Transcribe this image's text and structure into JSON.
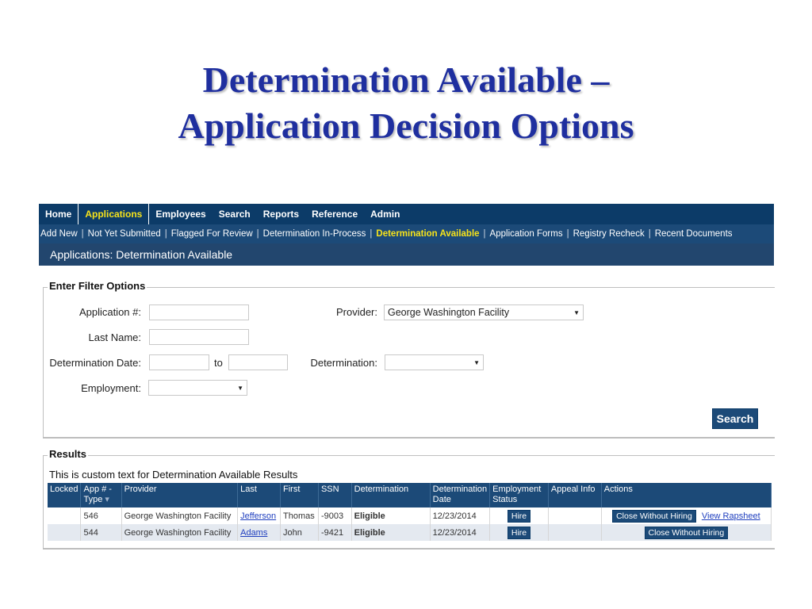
{
  "slide": {
    "title_line1": "Determination Available –",
    "title_line2": "Application Decision Options"
  },
  "topnav": {
    "items": [
      "Home",
      "Applications",
      "Employees",
      "Search",
      "Reports",
      "Reference",
      "Admin"
    ],
    "active": "Applications"
  },
  "subnav": {
    "items": [
      "Add New",
      "Not Yet Submitted",
      "Flagged For Review",
      "Determination In-Process",
      "Determination Available",
      "Application Forms",
      "Registry Recheck",
      "Recent Documents"
    ],
    "active": "Determination Available"
  },
  "page_header": "Applications: Determination Available",
  "filter": {
    "legend": "Enter Filter Options",
    "application_label": "Application #:",
    "application_value": "",
    "last_name_label": "Last Name:",
    "last_name_value": "",
    "determination_date_label": "Determination Date:",
    "date_from": "",
    "to_label": "to",
    "date_to": "",
    "employment_label": "Employment:",
    "employment_value": "",
    "provider_label": "Provider:",
    "provider_value": "George Washington Facility",
    "determination_label": "Determination:",
    "determination_value": "",
    "search_button": "Search"
  },
  "results": {
    "legend": "Results",
    "custom_text": "This is custom text for Determination Available Results",
    "columns": {
      "locked": "Locked",
      "app_type": "App # - Type",
      "sort": "▾",
      "provider": "Provider",
      "last": "Last",
      "first": "First",
      "ssn": "SSN",
      "determination": "Determination",
      "det_date": "Determination Date",
      "emp_status": "Employment Status",
      "appeal": "Appeal Info",
      "actions": "Actions"
    },
    "rows": [
      {
        "app": "546",
        "provider": "George Washington Facility",
        "last": "Jefferson",
        "first": "Thomas",
        "ssn": "-9003",
        "determination": "Eligible",
        "date": "12/23/2014",
        "emp_button": "Hire",
        "appeal": "",
        "action_button": "Close Without Hiring",
        "action_link": "View Rapsheet"
      },
      {
        "app": "544",
        "provider": "George Washington Facility",
        "last": "Adams",
        "first": "John",
        "ssn": "-9421",
        "determination": "Eligible",
        "date": "12/23/2014",
        "emp_button": "Hire",
        "appeal": "",
        "action_button": "Close Without Hiring",
        "action_link": ""
      }
    ]
  },
  "colors": {
    "title": "#1f2f9f",
    "nav_bg": "#0c3b68",
    "active_nav": "#f7e31a",
    "eligible": "#2b9a2b"
  },
  "icons": {
    "dropdown": "chevron-down-icon"
  }
}
